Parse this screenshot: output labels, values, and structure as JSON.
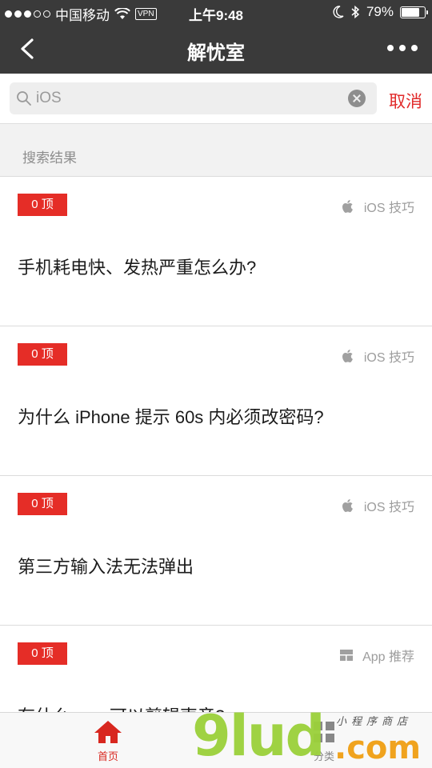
{
  "status_bar": {
    "carrier": "中国移动",
    "vpn": "VPN",
    "time": "上午9:48",
    "battery": "79%",
    "battery_level": 0.79
  },
  "nav": {
    "title": "解忧室"
  },
  "search": {
    "value": "iOS",
    "cancel_label": "取消"
  },
  "section_label": "搜索结果",
  "items": [
    {
      "badge": "0 顶",
      "category": "iOS 技巧",
      "category_icon": "apple-icon",
      "title": "手机耗电快、发热严重怎么办?"
    },
    {
      "badge": "0 顶",
      "category": "iOS 技巧",
      "category_icon": "apple-icon",
      "title": "为什么 iPhone 提示 60s 内必须改密码?"
    },
    {
      "badge": "0 顶",
      "category": "iOS 技巧",
      "category_icon": "apple-icon",
      "title": "第三方输入法无法弹出"
    },
    {
      "badge": "0 顶",
      "category": "App 推荐",
      "category_icon": "app-grid-icon",
      "title": "有什么 app 可以剪辑声音?"
    }
  ],
  "tabbar": {
    "home_label": "首页",
    "category_label": "分类"
  },
  "watermark": {
    "brand": "9lud",
    "domain": ".com",
    "subtitle": "小程序商店"
  },
  "colors": {
    "accent": "#e52d27",
    "nav_bg": "#3a3a3a",
    "watermark_green": "#9bd13a",
    "watermark_orange": "#f0a31e"
  }
}
